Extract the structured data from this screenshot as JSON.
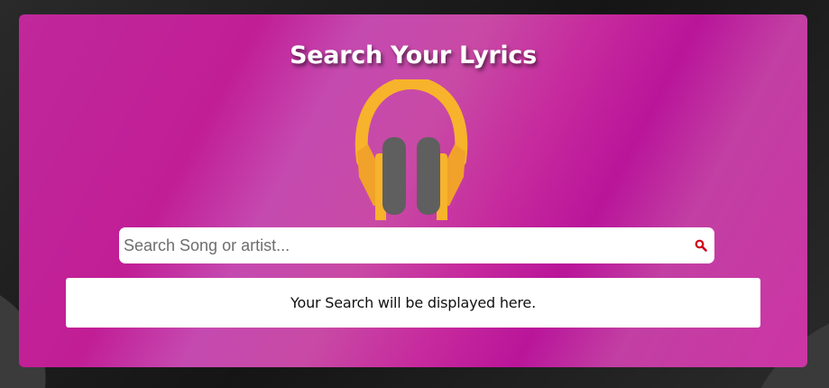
{
  "app": {
    "title": "Search Your Lyrics",
    "headphones_icon": "headphones-icon"
  },
  "search": {
    "placeholder": "Search Song or artist...",
    "value": "",
    "icon": "search-icon",
    "icon_color": "#d0021b"
  },
  "result": {
    "message": "Your Search will be displayed here."
  },
  "colors": {
    "card_accent": "#c11e96",
    "headphone_band": "#f7b32b",
    "headphone_cup": "#5f5f5f",
    "background": "#1e1e1e"
  }
}
